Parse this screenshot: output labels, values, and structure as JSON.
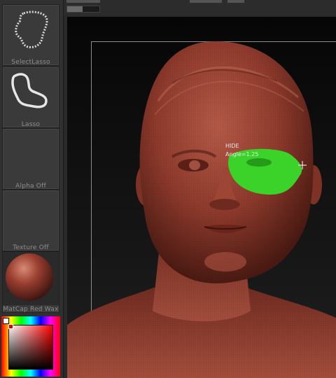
{
  "sidebar": {
    "tools": [
      {
        "label": "SelectLasso",
        "icon": "select-lasso-icon"
      },
      {
        "label": "Lasso",
        "icon": "lasso-icon"
      },
      {
        "label": "Alpha  Off",
        "icon": "alpha-icon"
      },
      {
        "label": "Texture  Off",
        "icon": "texture-icon"
      },
      {
        "label": "MatCap  Red  Wax",
        "icon": "matcap-sphere-icon"
      }
    ]
  },
  "hud": {
    "mode": "HIDE",
    "angle": "Angle=1.25"
  },
  "colors": {
    "selection": "#3bd22a",
    "skin": "#8e3a2c",
    "primary_color": "#ffffff"
  }
}
